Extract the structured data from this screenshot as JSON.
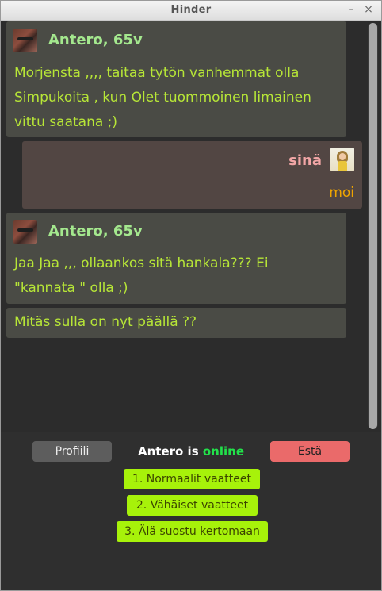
{
  "window": {
    "title": "Hinder",
    "minimize_glyph": "–",
    "close_glyph": "×"
  },
  "messages": [
    {
      "sender": "Antero, 65v",
      "lines": [
        "Morjensta ,,,, taitaa tytön vanhemmat olla",
        "Simpukoita , kun Olet tuommoinen limainen",
        "vittu saatana ;)"
      ]
    },
    {
      "sender": "sinä",
      "text": "moi"
    },
    {
      "sender": "Antero, 65v",
      "lines": [
        "Jaa Jaa ,,, ollaankos sitä hankala??? Ei",
        "\"kannata \" olla ;)"
      ]
    },
    {
      "lines": [
        "Mitäs sulla on nyt päällä ??"
      ]
    }
  ],
  "footer": {
    "profile_button": "Profiili",
    "block_button": "Estä",
    "status_prefix": "Antero is",
    "status_value": "online",
    "replies": [
      "1. Normaalit vaatteet",
      "2. Vähäiset vaatteet",
      "3. Älä suostu kertomaan"
    ]
  },
  "colors": {
    "background": "#2c2c2c",
    "incoming_bubble": "#4a4b45",
    "outgoing_bubble": "#524643",
    "incoming_text": "#b7e637",
    "incoming_name": "#a4e88e",
    "self_name": "#f2a6a6",
    "self_text": "#f0a500",
    "online": "#22e14a",
    "block_button": "#ea6a6a",
    "reply_button": "#a7f20a"
  },
  "icons": {
    "antero_avatar": "avatar-photo",
    "self_avatar": "avatar-photo"
  }
}
